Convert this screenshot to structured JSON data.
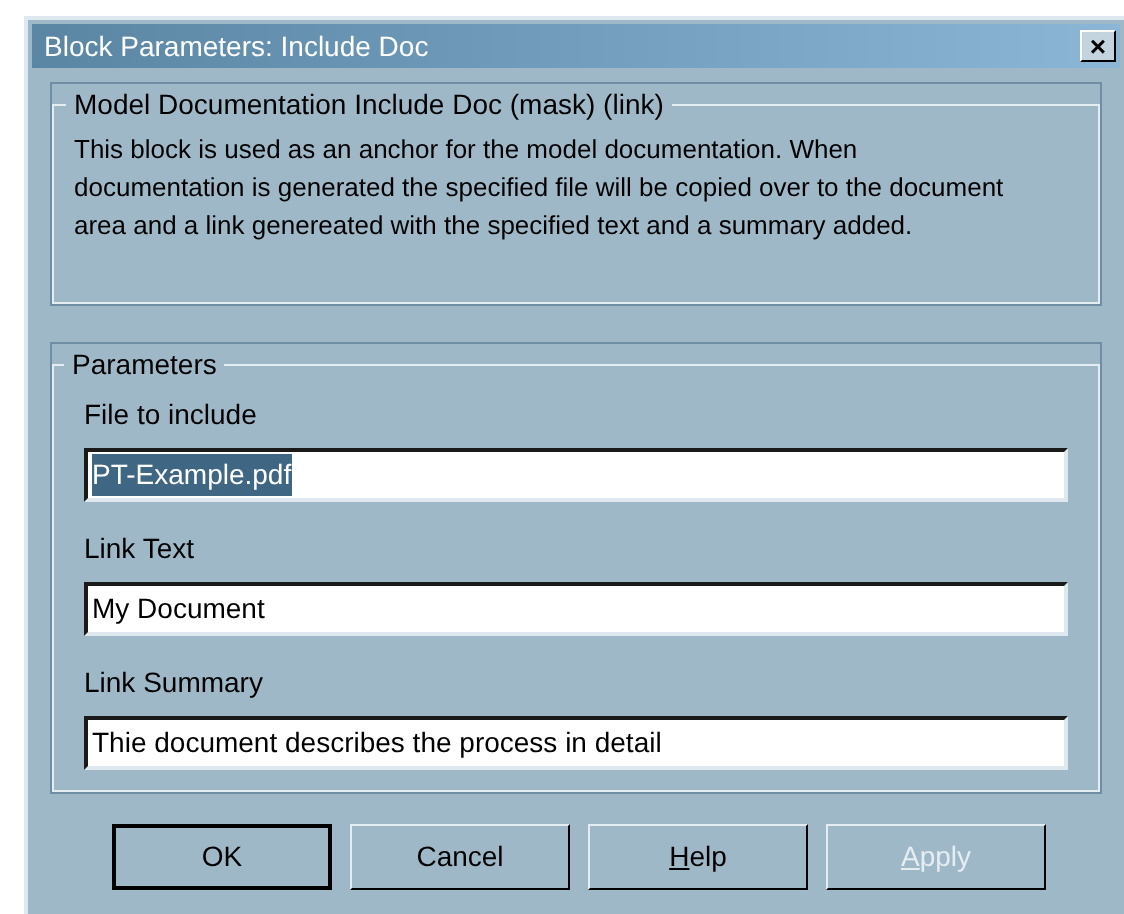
{
  "window": {
    "title": "Block Parameters: Include Doc",
    "close_glyph": "×"
  },
  "description_group": {
    "title": "Model Documentation Include Doc (mask) (link)",
    "text": "This block is used as an anchor for the model documentation.  When documentation is generated the specified file will be copied over to the document area and a link genereated with the specified text and a summary added."
  },
  "parameters_group": {
    "title": "Parameters",
    "fields": [
      {
        "label": "File to include",
        "value": "PT-Example.pdf",
        "text_selected": true
      },
      {
        "label": "Link Text",
        "value": "My Document",
        "text_selected": false
      },
      {
        "label": "Link Summary",
        "value": "Thie document describes the process in detail",
        "text_selected": false
      }
    ]
  },
  "buttons": [
    {
      "label": "OK",
      "default": true,
      "disabled": false,
      "first_letter_underlined": false
    },
    {
      "label": "Cancel",
      "default": false,
      "disabled": false,
      "first_letter_underlined": false
    },
    {
      "label": "Help",
      "default": false,
      "disabled": false,
      "first_letter_underlined": true
    },
    {
      "label": "Apply",
      "default": false,
      "disabled": true,
      "first_letter_underlined": true
    }
  ]
}
